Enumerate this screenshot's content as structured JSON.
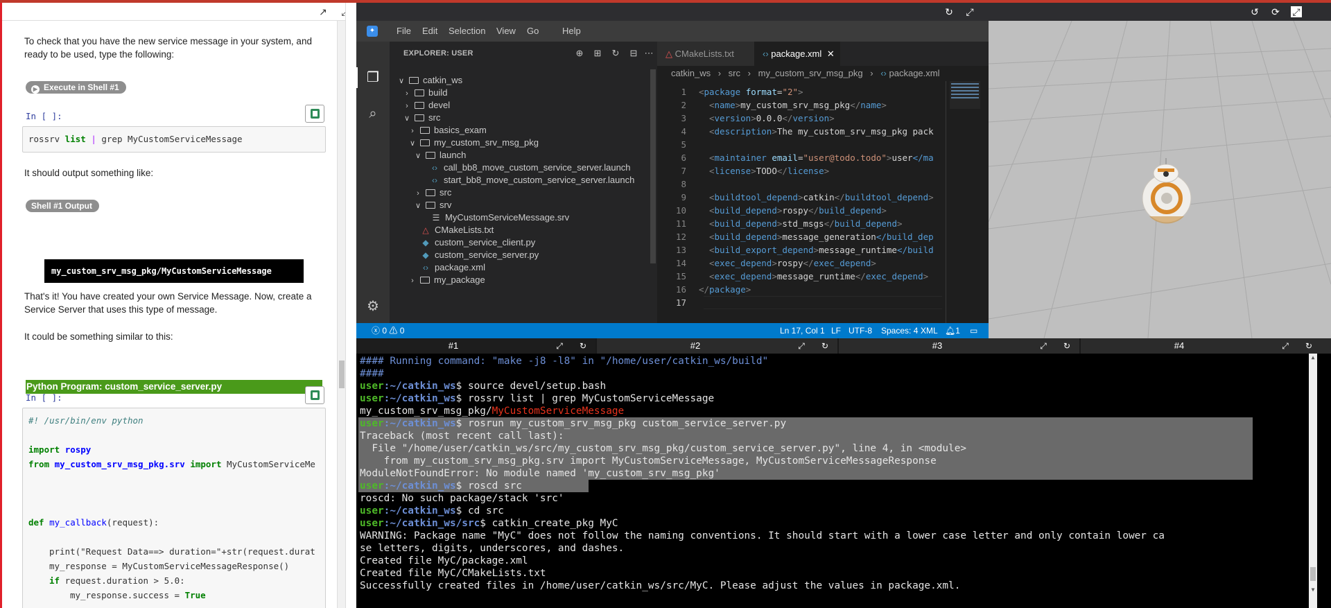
{
  "notebook": {
    "para1": "To check that you have the new service message in your system, and ready to be used, type the following:",
    "execute_label": "Execute in Shell #1",
    "in_label_1": "In [ ]:",
    "cmd_1_part1": "rossrv",
    "cmd_1_part2": " list ",
    "cmd_1_part3": "|",
    "cmd_1_part4": " grep MyCustomServiceMessage",
    "para2": "It should output something like:",
    "output_pill": "Shell #1 Output",
    "output_text": "my_custom_srv_msg_pkg/MyCustomServiceMessage",
    "para3": "That's it! You have created your own Service Message. Now, create a Service Server that uses this type of message.",
    "para4": "It could be something similar to this:",
    "program_heading": "Python Program: custom_service_server.py",
    "in_label_2": "In [ ]:",
    "code": {
      "shebang": "#! /usr/bin/env python",
      "import_kw": "import",
      "import_mod": "rospy",
      "from_kw": "from",
      "from_mod": "my_custom_srv_msg_pkg.srv",
      "from_import": "import",
      "from_names": "MyCustomServiceMe",
      "def_kw": "def",
      "def_name": "my_callback",
      "def_rest": "(request):",
      "print_line": "print(\"Request Data==> duration=\"+str(request.durat",
      "resp_line": "my_response = MyCustomServiceMessageResponse()",
      "if_kw": "if",
      "if_rest": " request.duration > 5.0:",
      "success_line": "my_response.success = ",
      "true_kw": "True"
    }
  },
  "vscode": {
    "menu": [
      "File",
      "Edit",
      "Selection",
      "View",
      "Go",
      "Help"
    ],
    "explorer_title": "EXPLORER: USER",
    "tree": [
      {
        "label": "catkin_ws",
        "kind": "folder-open"
      },
      {
        "label": "build",
        "kind": "folder"
      },
      {
        "label": "devel",
        "kind": "folder"
      },
      {
        "label": "src",
        "kind": "folder-open"
      },
      {
        "label": "basics_exam",
        "kind": "folder"
      },
      {
        "label": "my_custom_srv_msg_pkg",
        "kind": "folder-open"
      },
      {
        "label": "launch",
        "kind": "folder-open"
      },
      {
        "label": "call_bb8_move_custom_service_server.launch",
        "kind": "xml"
      },
      {
        "label": "start_bb8_move_custom_service_server.launch",
        "kind": "xml"
      },
      {
        "label": "src",
        "kind": "folder"
      },
      {
        "label": "srv",
        "kind": "folder-open"
      },
      {
        "label": "MyCustomServiceMessage.srv",
        "kind": "file"
      },
      {
        "label": "CMakeLists.txt",
        "kind": "cmake"
      },
      {
        "label": "custom_service_client.py",
        "kind": "py"
      },
      {
        "label": "custom_service_server.py",
        "kind": "py"
      },
      {
        "label": "package.xml",
        "kind": "xml"
      },
      {
        "label": "my_package",
        "kind": "folder"
      }
    ],
    "tabs": [
      {
        "label": "CMakeLists.txt",
        "active": false
      },
      {
        "label": "package.xml",
        "active": true
      }
    ],
    "breadcrumbs": [
      "catkin_ws",
      "src",
      "my_custom_srv_msg_pkg",
      "package.xml"
    ],
    "line_numbers": [
      "1",
      "2",
      "3",
      "4",
      "5",
      "6",
      "7",
      "8",
      "9",
      "10",
      "11",
      "12",
      "13",
      "14",
      "15",
      "16",
      "17"
    ],
    "xml": {
      "l1_tag": "package",
      "l1_attr": "format",
      "l1_val": "\"2\"",
      "name_tag": "name",
      "name_val": "my_custom_srv_msg_pkg",
      "version_tag": "version",
      "version_val": "0.0.0",
      "desc_tag": "description",
      "desc_val": "The my_custom_srv_msg_pkg pack",
      "maint_tag": "maintainer",
      "maint_attr": "email",
      "maint_email": "\"user@todo.todo\"",
      "maint_val": "user",
      "maint_close": "</ma",
      "lic_tag": "license",
      "lic_val": "TODO",
      "bt_tag": "buildtool_depend",
      "bt_val": "catkin",
      "bd_tag": "build_depend",
      "bd1": "rospy",
      "bd2": "std_msgs",
      "bd3": "message_generation",
      "bd3_close": "</build_dep",
      "bed_tag": "build_export_depend",
      "bed_val": "message_runtime",
      "bed_close": "</build",
      "ed_tag": "exec_depend",
      "ed1": "rospy",
      "ed2": "message_runtime",
      "close_tag": "package"
    },
    "status": {
      "errors": "0",
      "warnings": "0",
      "position": "Ln 17, Col 1",
      "eol": "LF",
      "encoding": "UTF-8",
      "spaces": "Spaces: 4",
      "language": "XML",
      "notifications": "1"
    }
  },
  "terminal_tabs": [
    "#1",
    "#2",
    "#3",
    "#4"
  ],
  "terminal": {
    "prompt_user": "user",
    "l1": "#### Running command: \"make -j8 -l8\" in \"/home/user/catkin_ws/build\"",
    "l2": "####",
    "path_ws": ":~/catkin_ws",
    "path_src": ":~/catkin_ws/src",
    "c1": "$ source devel/setup.bash",
    "c2": "$ rossrv list | grep MyCustomServiceMessage",
    "o2a": "my_custom_srv_msg_pkg/",
    "o2b": "MyCustomServiceMessage",
    "c3": "$ rosrun my_custom_srv_msg_pkg custom_service_server.py",
    "tb1": "Traceback (most recent call last):",
    "tb2": "  File \"/home/user/catkin_ws/src/my_custom_srv_msg_pkg/custom_service_server.py\", line 4, in <module>",
    "tb3": "    from my_custom_srv_msg_pkg.srv import MyCustomServiceMessage, MyCustomServiceMessageResponse",
    "tb4": "ModuleNotFoundError: No module named 'my_custom_srv_msg_pkg'",
    "c4": "$ roscd src",
    "o4": "roscd: No such package/stack 'src'",
    "c5": "$ cd src",
    "c6": "$ catkin_create_pkg MyC",
    "w1": "WARNING: Package name \"MyC\" does not follow the naming conventions. It should start with a lower case letter and only contain lower ca",
    "w2": "se letters, digits, underscores, and dashes.",
    "cr1": "Created file MyC/package.xml",
    "cr2": "Created file MyC/CMakeLists.txt",
    "cr3": "Successfully created files in /home/user/catkin_ws/src/MyC. Please adjust the values in package.xml."
  },
  "colors": {
    "accent_red": "#e0202a",
    "vscode_status": "#007acc",
    "program_heading_bg": "#4a9a1a",
    "terminal_user": "#4eb928",
    "terminal_path": "#6d8fd6"
  }
}
